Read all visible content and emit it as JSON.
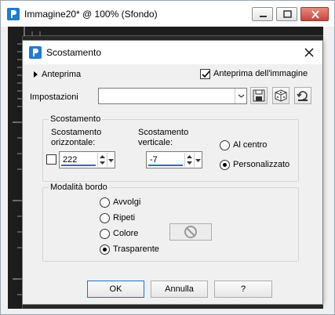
{
  "window": {
    "title": "Immagine20* @ 100% (Sfondo)",
    "icon": "paintshop-pro-icon"
  },
  "dialog": {
    "title": "Scostamento",
    "preview_toggle": "Anteprima",
    "image_preview": {
      "label": "Anteprima dell'immagine",
      "checked": true
    },
    "settings_label": "Impostazioni",
    "settings_value": "",
    "offset_group": {
      "title": "Scostamento",
      "horizontal_label_1": "Scostamento",
      "horizontal_label_2": "orizzontale:",
      "horizontal_value": "222",
      "vertical_label_1": "Scostamento",
      "vertical_label_2": "verticale:",
      "vertical_value": "-7",
      "radio_center": "Al centro",
      "radio_custom": "Personalizzato",
      "selected": "Personalizzato"
    },
    "edge_group": {
      "title": "Modalità bordo",
      "options": [
        "Avvolgi",
        "Ripeti",
        "Colore",
        "Trasparente"
      ],
      "selected": "Trasparente"
    },
    "buttons": {
      "ok": "OK",
      "cancel": "Annulla",
      "help": "?"
    }
  },
  "colors": {
    "accent": "#1f6fd1",
    "canvas": "#2b2b2b"
  }
}
